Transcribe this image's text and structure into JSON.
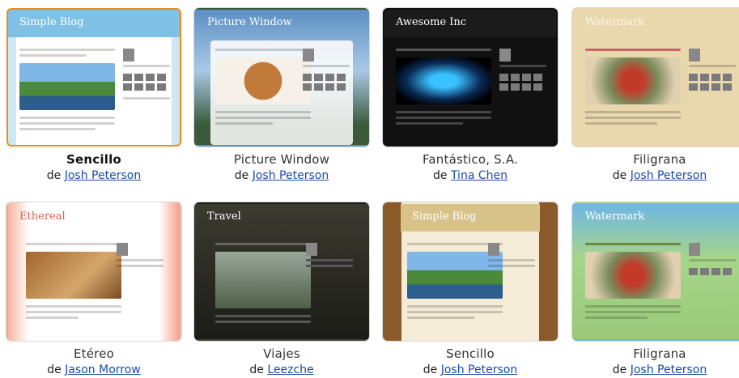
{
  "tiles": [
    {
      "title": "Sencillo",
      "by": "de",
      "author": "Josh Peterson",
      "header_text": "Simple Blog"
    },
    {
      "title": "Picture Window",
      "by": "de",
      "author": "Josh Peterson",
      "header_text": "Picture Window"
    },
    {
      "title": "Fantástico, S.A.",
      "by": "de",
      "author": "Tina Chen",
      "header_text": "Awesome Inc"
    },
    {
      "title": "Filigrana",
      "by": "de",
      "author": "Josh Peterson",
      "header_text": "Watermark"
    },
    {
      "title": "Etéreo",
      "by": "de",
      "author": "Jason Morrow",
      "header_text": "Ethereal"
    },
    {
      "title": "Viajes",
      "by": "de",
      "author": "Leezche",
      "header_text": "Travel"
    },
    {
      "title": "Sencillo",
      "by": "de",
      "author": "Josh Peterson",
      "header_text": "Simple Blog"
    },
    {
      "title": "Filigrana",
      "by": "de",
      "author": "Josh Peterson",
      "header_text": "Watermark"
    }
  ],
  "selected_index": 0,
  "colors": {
    "selected_border": "#f28a1b",
    "link": "#1a4aa8"
  }
}
